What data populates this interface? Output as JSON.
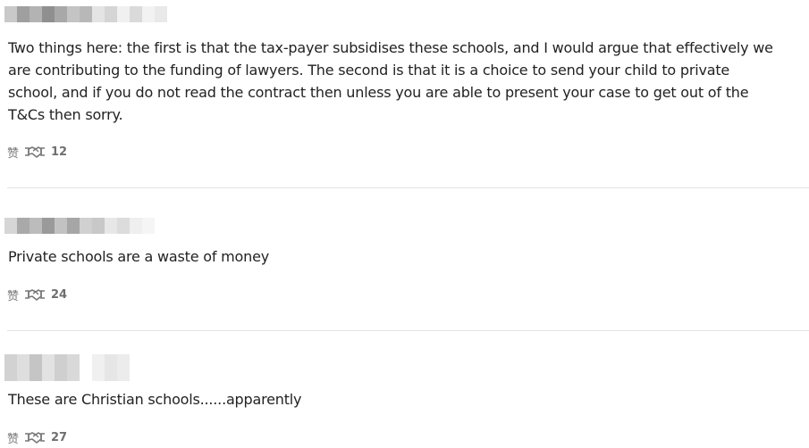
{
  "comments": [
    {
      "author_blurred": "",
      "text": "Two things here: the first is that the tax-payer subsidises these schools, and I would argue that effectively we are contributing to the funding of lawyers. The second is that it is a choice to send your child to private school, and if you do not read the contract then unless you are able to present your case to get out of the T&Cs then sorry.",
      "like_label": "赞",
      "like_count": "12"
    },
    {
      "author_blurred": "",
      "text": "Private schools are a waste of money",
      "like_label": "赞",
      "like_count": "24"
    },
    {
      "author_blurred": "",
      "text": "These are Christian schools......apparently",
      "like_label": "赞",
      "like_count": "27"
    }
  ],
  "icons": {
    "like": "handshake-icon"
  },
  "colors": {
    "text": "#222222",
    "meta": "#7a7a7a",
    "divider": "#e3e3e3"
  }
}
